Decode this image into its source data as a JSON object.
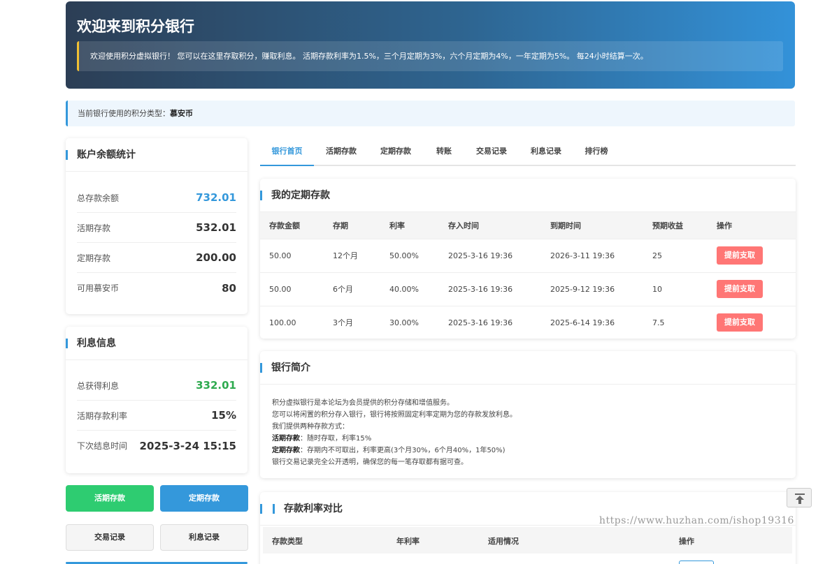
{
  "header": {
    "title": "欢迎来到积分银行",
    "notice": "欢迎使用积分虚拟银行！ 您可以在这里存取积分，赚取利息。 活期存款利率为1.5%，三个月定期为3%，六个月定期为4%，一年定期为5%。 每24小时结算一次。"
  },
  "currency": {
    "label": "当前银行使用的积分类型：",
    "value": "慕安币"
  },
  "balance": {
    "title": "账户余额统计",
    "rows": [
      {
        "label": "总存款余额",
        "value": "732.01"
      },
      {
        "label": "活期存款",
        "value": "532.01"
      },
      {
        "label": "定期存款",
        "value": "200.00"
      },
      {
        "label": "可用慕安币",
        "value": "80"
      }
    ]
  },
  "interest": {
    "title": "利息信息",
    "rows": [
      {
        "label": "总获得利息",
        "value": "332.01"
      },
      {
        "label": "活期存款利率",
        "value": "15%"
      },
      {
        "label": "下次结息时间",
        "value": "2025-3-24 15:15"
      }
    ]
  },
  "actions": {
    "demand_deposit": "活期存款",
    "fixed_deposit": "定期存款",
    "transactions": "交易记录",
    "interest_records": "利息记录"
  },
  "tabs": [
    "银行首页",
    "活期存款",
    "定期存款",
    "转账",
    "交易记录",
    "利息记录",
    "排行榜"
  ],
  "fixed": {
    "title": "我的定期存款",
    "columns": [
      "存款金额",
      "存期",
      "利率",
      "存入时间",
      "到期时间",
      "预期收益",
      "操作"
    ],
    "rows": [
      {
        "amount": "50.00",
        "term": "12个月",
        "rate": "50.00%",
        "start": "2025-3-16 19:36",
        "end": "2026-3-11 19:36",
        "yield": "25",
        "action": "提前支取"
      },
      {
        "amount": "50.00",
        "term": "6个月",
        "rate": "40.00%",
        "start": "2025-3-16 19:36",
        "end": "2025-9-12 19:36",
        "yield": "10",
        "action": "提前支取"
      },
      {
        "amount": "100.00",
        "term": "3个月",
        "rate": "30.00%",
        "start": "2025-3-16 19:36",
        "end": "2025-6-14 19:36",
        "yield": "7.5",
        "action": "提前支取"
      }
    ]
  },
  "intro": {
    "title": "银行简介",
    "line1": "积分虚拟银行是本论坛为会员提供的积分存储和增值服务。",
    "line2": "您可以将闲置的积分存入银行，银行将按照固定利率定期为您的存款发放利息。",
    "line3": "我们提供两种存款方式：",
    "demand_label": "活期存款",
    "demand_text": "：随时存取，利率15%",
    "fixed_label": "定期存款",
    "fixed_text": "：存期内不可取出，利率更高(3个月30%，6个月40%，1年50%)",
    "line6": "银行交易记录完全公开透明，确保您的每一笔存取都有据可查。"
  },
  "rates": {
    "title": "存款利率对比",
    "columns": [
      "存款类型",
      "年利率",
      "适用情况",
      "操作"
    ]
  },
  "watermark": "https://www.huzhan.com/ishop19316",
  "colors": {
    "accent": "#3498db",
    "green": "#2ecc71",
    "withdraw": "#ff7675"
  }
}
